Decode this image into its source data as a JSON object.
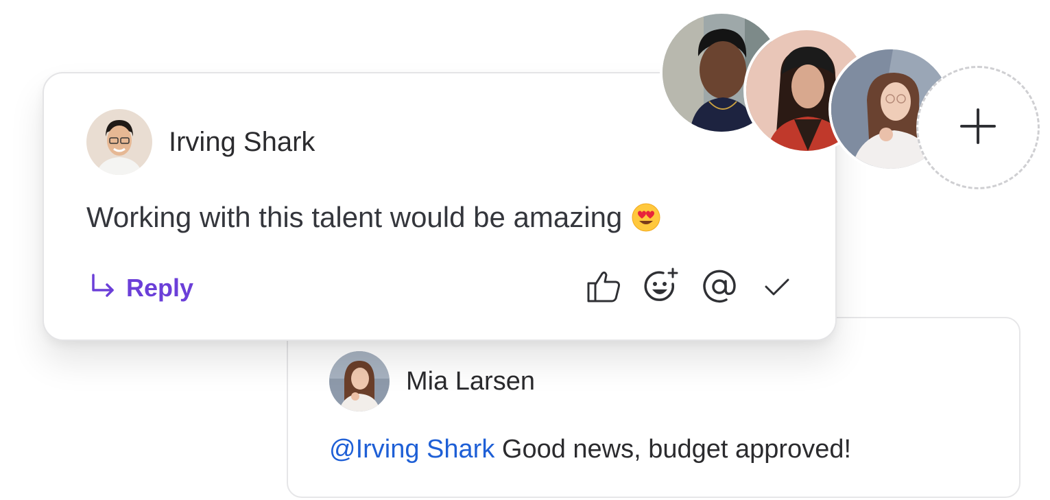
{
  "comment": {
    "author": "Irving Shark",
    "text": "Working with this talent would be amazing",
    "emoji_icon": "heart-eyes-emoji",
    "reply_label": "Reply",
    "actions": [
      "thumbs-up-icon",
      "add-reaction-icon",
      "mention-icon",
      "resolve-check-icon"
    ]
  },
  "reply": {
    "author": "Mia Larsen",
    "mention": "@Irving Shark",
    "text": " Good news, budget approved!"
  },
  "participants": {
    "add_icon": "plus-icon"
  },
  "colors": {
    "accent": "#6b3fd8",
    "mention": "#1e5fd6",
    "text": "#2b2b2e",
    "border": "#e4e4e6"
  }
}
